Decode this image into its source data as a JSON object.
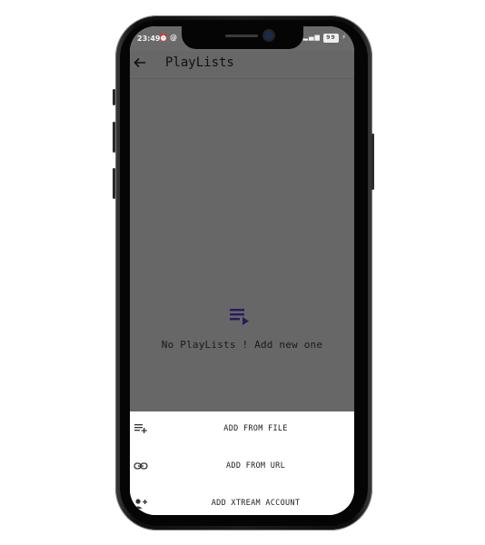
{
  "status_bar": {
    "time": "23:49",
    "left_icons": [
      "alarm-icon",
      "at-icon"
    ],
    "right_icons": [
      "vibrate-icon",
      "signal-icon",
      "signal-icon",
      "battery-icon",
      "charging-icon"
    ],
    "battery": "99"
  },
  "toolbar": {
    "title": "PlayLists",
    "back_icon": "arrow-back-icon"
  },
  "empty_state": {
    "icon": "playlist-play-icon",
    "icon_color": "#2a1a5a",
    "message": "No PlayLists ! Add new one"
  },
  "sheet": {
    "items": [
      {
        "label": "ADD FROM FILE",
        "icon": "playlist-add-icon"
      },
      {
        "label": "ADD FROM URL",
        "icon": "link-icon"
      },
      {
        "label": "ADD XTREAM ACCOUNT",
        "icon": "person-add-icon"
      }
    ]
  },
  "colors": {
    "scrim": "#676767",
    "sheet_bg": "#ffffff"
  }
}
